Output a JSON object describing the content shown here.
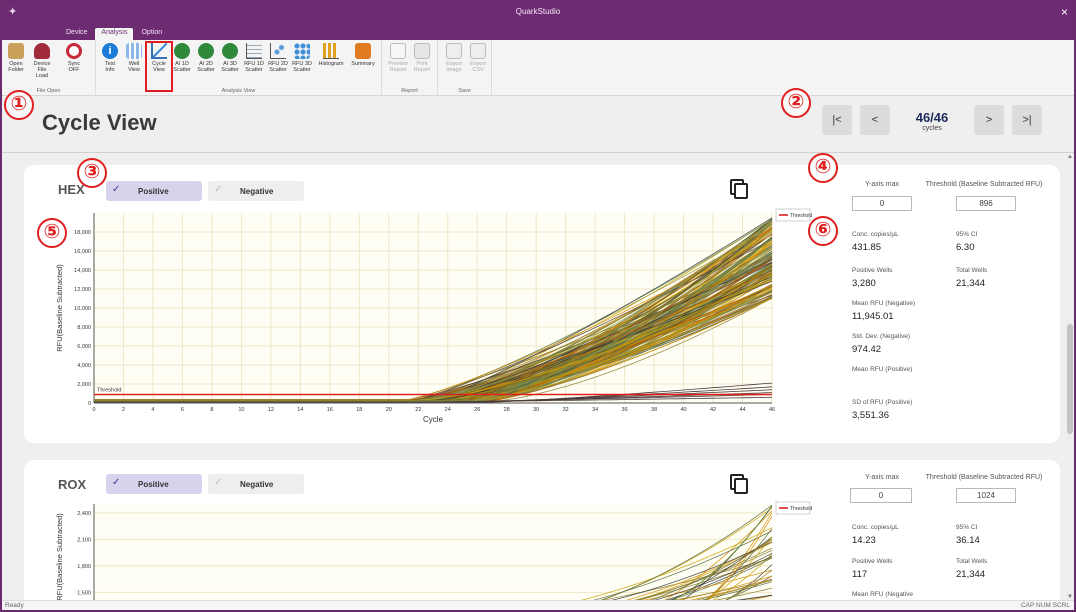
{
  "window": {
    "title": "QuarkStudio",
    "close_label": "×"
  },
  "tabs": [
    {
      "label": "Device",
      "active": false
    },
    {
      "label": "Analysis",
      "active": true
    },
    {
      "label": "Option",
      "active": false
    }
  ],
  "ribbon": {
    "groups": {
      "file_open": "File Open",
      "analysis_view": "Analysis View",
      "report": "Report",
      "save": "Save"
    },
    "buttons": {
      "open_folder": "Open\nFolder",
      "device_file_load": "Device\nFile Load",
      "sync_off": "Sync\nOFF",
      "test_info": "Test\nInfo",
      "well_view": "Well\nView",
      "cycle_view": "Cycle\nView",
      "ai_1d_scatter": "AI 1D\nScatter",
      "ai_2d_scatter": "AI 2D\nScatter",
      "ai_3d_scatter": "AI 3D\nScatter",
      "rfu_1d_scatter": "RFU 1D\nScatter",
      "rfu_2d_scatter": "RFU 2D\nScatter",
      "rfu_3d_scatter": "RFU 3D\nScatter",
      "histogram": "Histogram",
      "summary": "Summary",
      "preview_report": "Preview\nReport",
      "print_report": "Print\nReport",
      "export_image": "Export\nImage",
      "export_csv": "Export\nCSV"
    }
  },
  "page": {
    "title": "Cycle View"
  },
  "navigation": {
    "first": "|<",
    "prev": "<",
    "next": ">",
    "last": ">|",
    "current": "46/46",
    "unit": "cycles"
  },
  "markers": [
    "①",
    "②",
    "③",
    "④",
    "⑤",
    "⑥"
  ],
  "panels": [
    {
      "dye": "HEX",
      "positive_label": "Positive",
      "negative_label": "Negative",
      "yaxis_max_label": "Y-axis max",
      "yaxis_max_value": "0",
      "threshold_label": "Threshold (Baseline Subtracted RFU)",
      "threshold_value": "896",
      "stats": {
        "conc_label": "Conc. copies/μL",
        "conc_value": "431.85",
        "ci_label": "95% CI",
        "ci_value": "6.30",
        "pos_wells_label": "Positive Wells",
        "pos_wells_value": "3,280",
        "total_wells_label": "Total Wells",
        "total_wells_value": "21,344",
        "mean_neg_label": "Mean RFU (Negative)",
        "mean_neg_value": "11,945.01",
        "sd_neg_label": "Std. Dev. (Negative)",
        "sd_neg_value": "974.42",
        "mean_pos_label": "Mean RFU (Positive)",
        "sd_pos_label": "SD of RFU (Positive)",
        "sd_pos_value": "3,551.36"
      }
    },
    {
      "dye": "ROX",
      "positive_label": "Positive",
      "negative_label": "Negative",
      "yaxis_max_label": "Y-axis max",
      "yaxis_max_value": "0",
      "threshold_label": "Threshold (Baseline Subtracted RFU)",
      "threshold_value": "1024",
      "stats": {
        "conc_label": "Conc. copies/μL",
        "conc_value": "14.23",
        "ci_label": "95% CI",
        "ci_value": "36.14",
        "pos_wells_label": "Positive Wells",
        "pos_wells_value": "117",
        "total_wells_label": "Total Wells",
        "total_wells_value": "21,344",
        "mean_neg_label": "Mean RFU (Negative"
      }
    }
  ],
  "chart_data": [
    {
      "type": "line",
      "title": "HEX",
      "xlabel": "Cycle",
      "ylabel": "RFU(Baseline Subtracted)",
      "xlim": [
        0,
        46
      ],
      "ylim": [
        0,
        20000
      ],
      "xticks": [
        0,
        2,
        4,
        6,
        8,
        10,
        12,
        14,
        16,
        18,
        20,
        22,
        24,
        26,
        28,
        30,
        32,
        34,
        36,
        38,
        40,
        42,
        44,
        46
      ],
      "yticks": [
        0,
        2000,
        4000,
        6000,
        8000,
        10000,
        12000,
        14000,
        16000,
        18000
      ],
      "ytick_labels": [
        "0",
        "2,000",
        "4,000",
        "6,000",
        "8,000",
        "10,000",
        "12,000",
        "14,000",
        "16,000",
        "18,000"
      ],
      "threshold": 896,
      "threshold_label": "Threshold",
      "legend": [
        "Threshold"
      ],
      "legend_position": "top-right",
      "grid": true,
      "series_colors": [
        "#c8a000",
        "#8a7a2a",
        "#5a6a3a",
        "#d68a00",
        "#3a3a3a",
        "#9a9a40",
        "#b05a10",
        "#6a8a5a"
      ],
      "curves": {
        "onset_cycle_min": 21,
        "onset_cycle_max": 27,
        "end_rfu_min": 11000,
        "end_rfu_max": 19500,
        "negative_end_rfu": [
          600,
          900,
          1100,
          1400,
          1700,
          2100
        ]
      }
    },
    {
      "type": "line",
      "title": "ROX",
      "ylabel": "RFU(Baseline Subtracted)",
      "ylim": [
        1300,
        2500
      ],
      "yticks": [
        1500,
        1800,
        2100,
        2400
      ],
      "ytick_labels": [
        "1,500",
        "1,800",
        "2,100",
        "2,400"
      ],
      "threshold": 1024,
      "legend": [
        "Threshold"
      ],
      "legend_position": "top-right",
      "grid": true,
      "series_colors": [
        "#c8a000",
        "#8a7a2a",
        "#5a6a3a",
        "#d68a00",
        "#3a3a3a"
      ]
    }
  ],
  "statusbar": {
    "left": "Ready",
    "right": "CAP  NUM  SCRL"
  }
}
